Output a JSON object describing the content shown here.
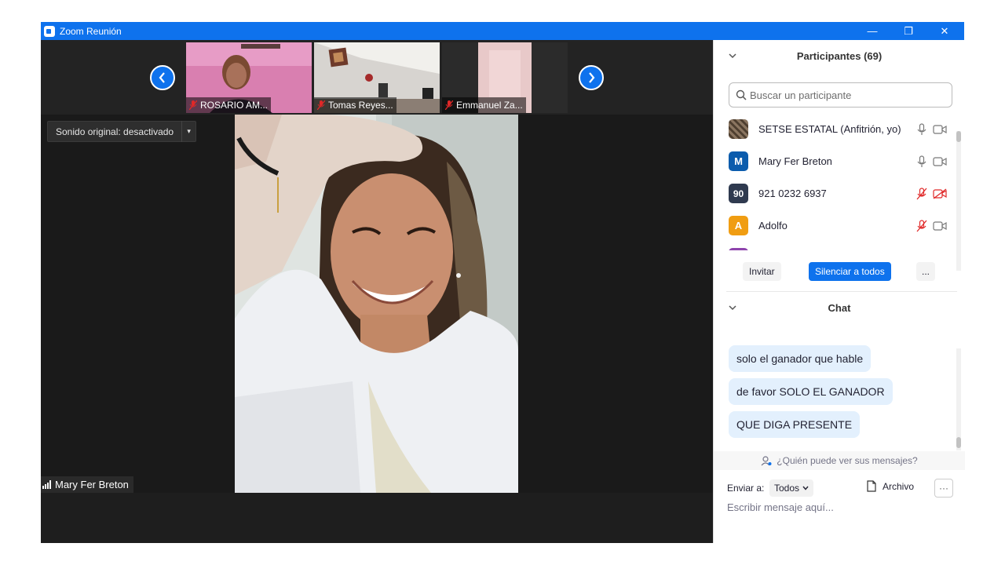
{
  "window": {
    "title": "Zoom Reunión",
    "minimize_glyph": "—",
    "maximize_glyph": "❐",
    "close_glyph": "✕"
  },
  "video": {
    "thumbnails": [
      {
        "name": "ROSARIO AM..."
      },
      {
        "name": "Tomas Reyes..."
      },
      {
        "name": "Emmanuel Za..."
      }
    ],
    "sound_toggle_label": "Sonido original: desactivado",
    "active_speaker": "Mary Fer Breton"
  },
  "participants": {
    "title": "Participantes (69)",
    "search_placeholder": "Buscar un participante",
    "list": [
      {
        "avatar": "",
        "name": "SETSE ESTATAL (Anfitrión, yo)",
        "mic": "on",
        "cam": "on",
        "avatar_color": "#6b5a45"
      },
      {
        "avatar": "M",
        "name": "Mary Fer Breton",
        "mic": "on",
        "cam": "on",
        "avatar_color": "#0b5cad"
      },
      {
        "avatar": "90",
        "name": "921 0232 6937",
        "mic": "off",
        "cam": "off",
        "avatar_color": "#2f3a4f"
      },
      {
        "avatar": "A",
        "name": "Adolfo",
        "mic": "off",
        "cam": "on",
        "avatar_color": "#f09d12"
      }
    ],
    "invite_label": "Invitar",
    "mute_all_label": "Silenciar a todos",
    "more_label": "..."
  },
  "chat": {
    "title": "Chat",
    "messages": [
      "solo el ganador que hable",
      "de favor SOLO EL GANADOR",
      "QUE DIGA PRESENTE"
    ],
    "privacy_notice": "¿Quién puede ver sus mensajes?",
    "send_to_label": "Enviar a:",
    "recipient": "Todos",
    "file_label": "Archivo",
    "more_label": "···",
    "input_placeholder": "Escribir mensaje aquí..."
  },
  "colors": {
    "accent": "#0e72ed",
    "muted_red": "#e02828"
  }
}
